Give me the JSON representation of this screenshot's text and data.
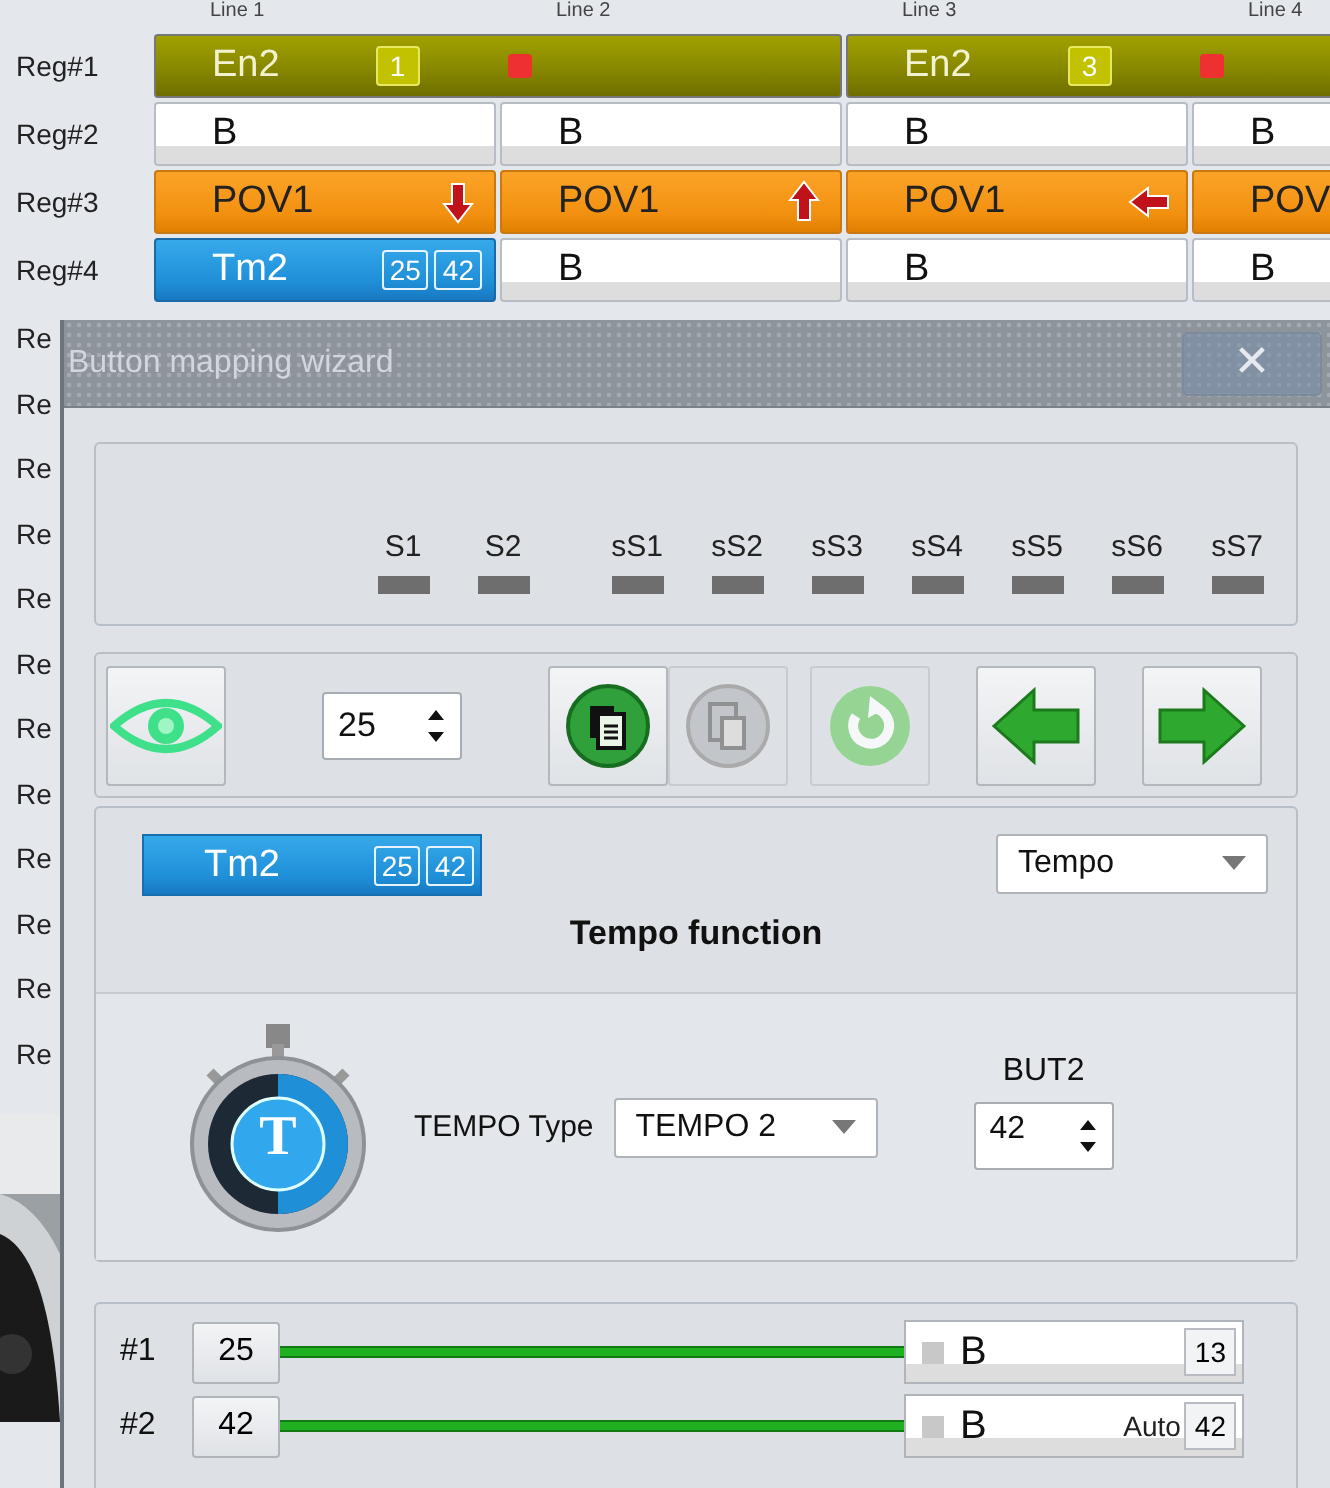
{
  "grid": {
    "columns": [
      "Line 1",
      "Line 2",
      "Line 3",
      "Line 4"
    ],
    "rows": [
      {
        "label": "Reg#1",
        "cells": [
          {
            "kind": "enable",
            "text": "En2",
            "badges": [
              "1"
            ],
            "active": true
          },
          "",
          {
            "kind": "enable",
            "text": "En2",
            "badges": [
              "3"
            ],
            "active": true
          },
          ""
        ]
      },
      {
        "label": "Reg#2",
        "cells": [
          {
            "kind": "button",
            "text": "B"
          },
          {
            "kind": "button",
            "text": "B"
          },
          {
            "kind": "button",
            "text": "B"
          },
          {
            "kind": "button",
            "text": "B"
          }
        ]
      },
      {
        "label": "Reg#3",
        "cells": [
          {
            "kind": "pov",
            "text": "POV1",
            "arrow": {
              "kind": "down"
            }
          },
          {
            "kind": "pov",
            "text": "POV1",
            "arrow": {
              "kind": "up"
            }
          },
          {
            "kind": "pov",
            "text": "POV1",
            "arrow": {
              "kind": "left"
            }
          },
          {
            "kind": "pov",
            "text": "POV"
          }
        ]
      },
      {
        "label": "Reg#4",
        "cells": [
          {
            "kind": "tempo",
            "text": "Tm2",
            "badges": [
              "25",
              "42"
            ]
          },
          {
            "kind": "button",
            "text": "B"
          },
          {
            "kind": "button",
            "text": "B"
          },
          {
            "kind": "button",
            "text": "B"
          }
        ]
      }
    ],
    "covered_rows": [
      "Re",
      "Re",
      "Re",
      "Re",
      "Re",
      "Re",
      "Re",
      "Re",
      "Re",
      "Re",
      "Re",
      "Re"
    ]
  },
  "wizard": {
    "title": "Button mapping wizard",
    "close": "✕",
    "signals": [
      "S1",
      "S2"
    ],
    "sub_signals": [
      "sS1",
      "sS2",
      "sS3",
      "sS4",
      "sS5",
      "sS6",
      "sS7"
    ],
    "toolbar": {
      "spinner": "25",
      "buttons": [
        {
          "kind": "eye",
          "disabled": false
        },
        {
          "kind": "copy",
          "disabled": false
        },
        {
          "kind": "paste",
          "disabled": true
        },
        {
          "kind": "reset",
          "disabled": true
        },
        {
          "kind": "back",
          "disabled": false
        },
        {
          "kind": "forward",
          "disabled": false
        }
      ]
    },
    "function": {
      "chip": {
        "text": "Tm2",
        "badges": [
          "25",
          "42"
        ]
      },
      "select": "Tempo",
      "title": "Tempo function",
      "icon_letter": "T",
      "type_label": "TEMPO Type",
      "type_select": "TEMPO 2",
      "button_label": "BUT2",
      "button_value": "42"
    },
    "mappings": [
      {
        "label": "#1",
        "source": "25",
        "target": "B",
        "value": "13"
      },
      {
        "label": "#2",
        "source": "42",
        "target": "B",
        "mode": "Auto",
        "value": "42"
      }
    ]
  }
}
